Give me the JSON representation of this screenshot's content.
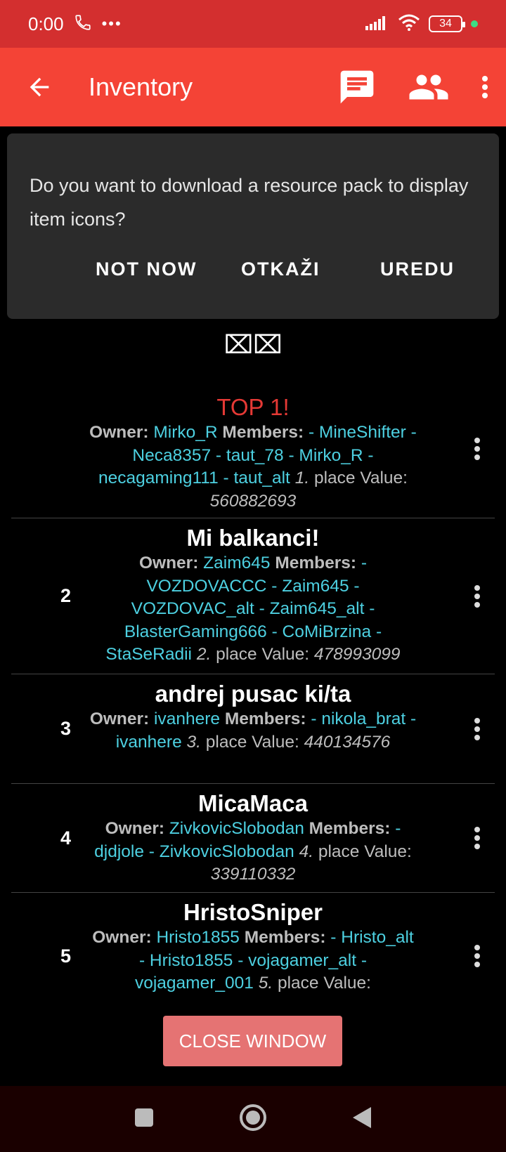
{
  "status_bar": {
    "time": "0:00",
    "battery": "34"
  },
  "app_bar": {
    "title": "Inventory"
  },
  "dialog": {
    "message": "Do you want to download a resource pack to display item icons?",
    "buttons": {
      "not_now": "NOT NOW",
      "cancel": "OTKAŽI",
      "ok": "UREDU"
    }
  },
  "header_glyph": "⌧⌧",
  "labels": {
    "owner": "Owner:",
    "members": "Members:",
    "place": "place",
    "value": "Value:"
  },
  "clans": [
    {
      "rank": "",
      "name": "TOP 1!",
      "owner": "Mirko_R",
      "members": "- MineShifter - Neca8357 - taut_78 - Mirko_R - necagaming111 - taut_alt",
      "place": "1.",
      "value": "560882693"
    },
    {
      "rank": "2",
      "name": "Mi balkanci!",
      "owner": "Zaim645",
      "members": "- VOZDOVACCC - Zaim645 - VOZDOVAC_alt - Zaim645_alt - BlasterGaming666 - CoMiBrzina - StaSeRadii",
      "place": "2.",
      "value": "478993099"
    },
    {
      "rank": "3",
      "name": "andrej pusac ki/ta",
      "owner": "ivanhere",
      "members": "- nikola_brat - ivanhere",
      "place": "3.",
      "value": "440134576"
    },
    {
      "rank": "4",
      "name": "MicaMaca",
      "owner": "ZivkovicSlobodan",
      "members": "- djdjole - ZivkovicSlobodan",
      "place": "4.",
      "value": "339110332"
    },
    {
      "rank": "5",
      "name": "HristoSniper",
      "owner": "Hristo1855",
      "members": "- Hristo_alt - Hristo1855 - vojagamer_alt - vojagamer_001",
      "place": "5.",
      "value": ""
    }
  ],
  "close_button": "CLOSE WINDOW",
  "colors": {
    "status_bar": "#d32f2f",
    "app_bar": "#f44336",
    "accent_name": "#4dd0e1",
    "top_title": "#e53935",
    "close_button": "#e57373"
  }
}
